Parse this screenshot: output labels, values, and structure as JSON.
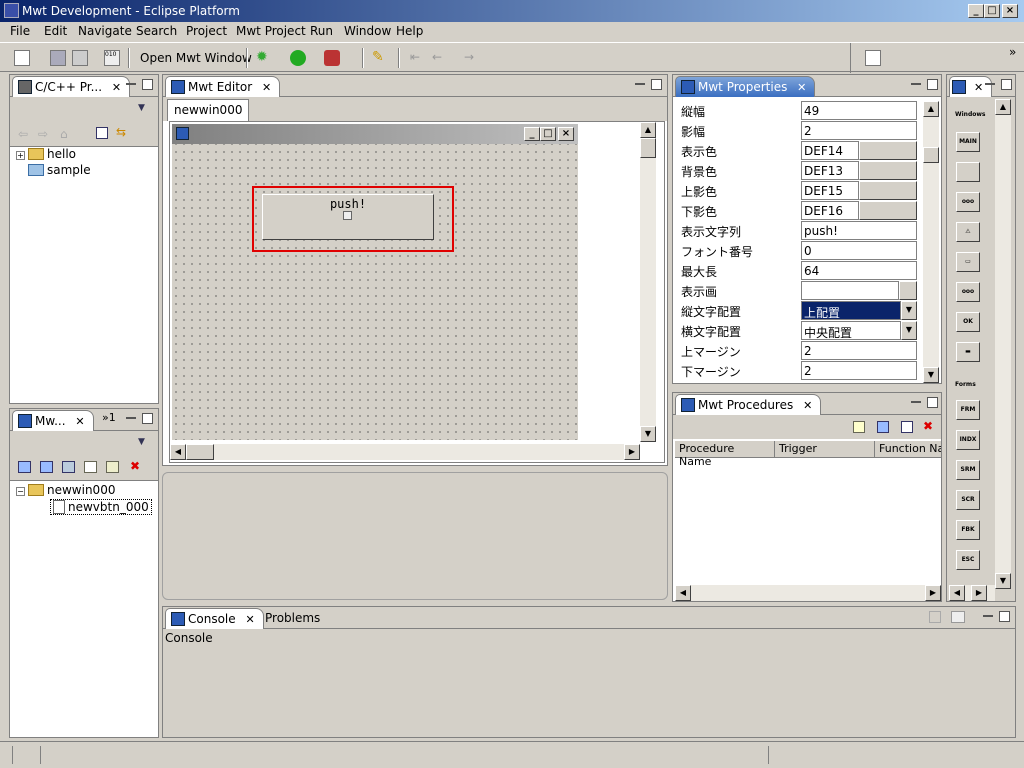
{
  "window": {
    "title": "Mwt Development - Eclipse Platform"
  },
  "menu": [
    "File",
    "Edit",
    "Navigate",
    "Search",
    "Project",
    "Mwt Project",
    "Run",
    "Window",
    "Help"
  ],
  "toolbar": {
    "open_mwt_window": "Open Mwt Window"
  },
  "cpp_view": {
    "title": "C/C++ Pr...",
    "items": [
      {
        "label": "hello",
        "expander": "+"
      },
      {
        "label": "sample"
      }
    ]
  },
  "mw_view": {
    "title": "Mw...",
    "overflow": "»1",
    "items": [
      {
        "label": "newwin000",
        "expander": "−"
      },
      {
        "label": "newvbtn_000"
      }
    ]
  },
  "editor": {
    "title": "Mwt Editor",
    "tab": "newwin000",
    "button_text": "push!"
  },
  "properties": {
    "title": "Mwt Properties",
    "rows": [
      {
        "name": "縦幅",
        "value": "49",
        "style": "text"
      },
      {
        "name": "影幅",
        "value": "2",
        "style": "text"
      },
      {
        "name": "表示色",
        "value": "DEF14",
        "style": "color"
      },
      {
        "name": "背景色",
        "value": "DEF13",
        "style": "color"
      },
      {
        "name": "上影色",
        "value": "DEF15",
        "style": "color"
      },
      {
        "name": "下影色",
        "value": "DEF16",
        "style": "color"
      },
      {
        "name": "表示文字列",
        "value": "push!",
        "style": "text"
      },
      {
        "name": "フォント番号",
        "value": "0",
        "style": "text"
      },
      {
        "name": "最大長",
        "value": "64",
        "style": "text"
      },
      {
        "name": "表示画",
        "value": "",
        "style": "browse"
      },
      {
        "name": "縦文字配置",
        "value": "上配置",
        "style": "combo-selected"
      },
      {
        "name": "横文字配置",
        "value": "中央配置",
        "style": "combo"
      },
      {
        "name": "上マージン",
        "value": "2",
        "style": "text"
      },
      {
        "name": "下マージン",
        "value": "2",
        "style": "text"
      }
    ]
  },
  "procedures": {
    "title": "Mwt Procedures",
    "columns": [
      "Procedure Name",
      "Trigger",
      "Function Na"
    ]
  },
  "palette": {
    "section1": "Windows",
    "section2": "Forms",
    "buttons1": [
      "MAIN",
      "",
      "ooo",
      "⚠",
      "▭",
      "ooo",
      "OK",
      "▬"
    ],
    "buttons2": [
      "FRM",
      "INDX",
      "SRM",
      "SCR",
      "FBK",
      "ESC"
    ]
  },
  "bottom": {
    "tab_console": "Console",
    "tab_problems": "Problems",
    "console_label": "Console"
  },
  "colors": {
    "selection": "#0a246a",
    "highlight": "#e00000",
    "active_tab": "#3a6ec1"
  }
}
